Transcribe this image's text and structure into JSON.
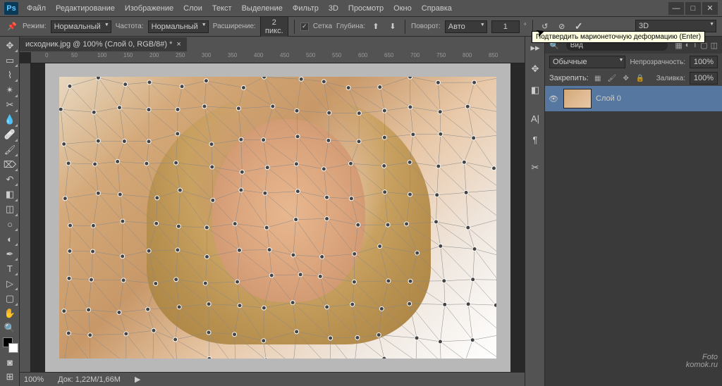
{
  "app": "Ps",
  "menu": [
    "Файл",
    "Редактирование",
    "Изображение",
    "Слои",
    "Текст",
    "Выделение",
    "Фильтр",
    "3D",
    "Просмотр",
    "Окно",
    "Справка"
  ],
  "window_controls": [
    "—",
    "□",
    "✕"
  ],
  "optbar": {
    "mode_label": "Режим:",
    "mode_value": "Нормальный",
    "density_label": "Частота:",
    "density_value": "Нормальный",
    "expansion_label": "Расширение:",
    "expansion_value": "2 пикс.",
    "mesh_label": "Сетка",
    "depth_label": "Глубина:",
    "rotate_label": "Поворот:",
    "rotate_value": "Авто",
    "angle_value": "1"
  },
  "workspace": "3D",
  "tooltip": "Подтвердить марионеточную деформацию (Enter)",
  "doc_title": "исходник.jpg @ 100% (Слой 0, RGB/8#) *",
  "ruler_ticks": [
    "0",
    "50",
    "100",
    "150",
    "200",
    "250",
    "300",
    "350",
    "400",
    "450",
    "500",
    "550",
    "600",
    "650",
    "700",
    "750",
    "800",
    "850"
  ],
  "status": {
    "zoom": "100%",
    "doc": "Док: 1,22M/1,66M"
  },
  "panels": {
    "search_placeholder": "Вид",
    "blend": "Обычные",
    "opacity_label": "Непрозрачность:",
    "opacity_value": "100%",
    "lock_label": "Закрепить:",
    "fill_label": "Заливка:",
    "fill_value": "100%",
    "layer_name": "Слой 0"
  },
  "watermark": {
    "l1": "Foto",
    "l2": "komok.ru"
  }
}
